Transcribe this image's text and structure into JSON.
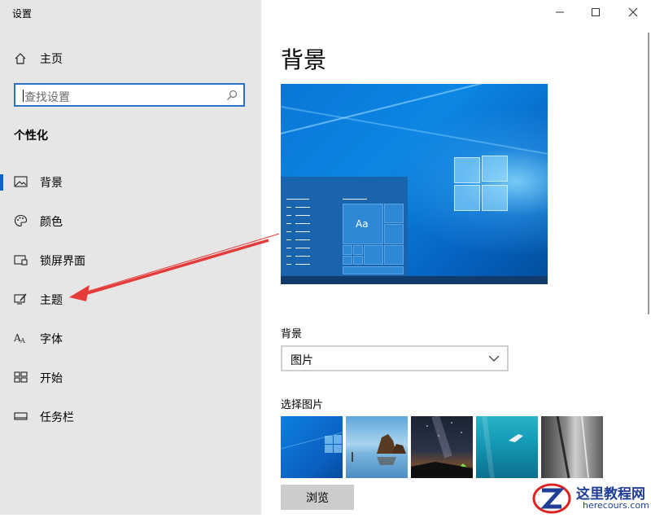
{
  "window": {
    "title": "设置"
  },
  "sidebar": {
    "home_label": "主页",
    "search_placeholder": "查找设置",
    "section_title": "个性化",
    "items": [
      {
        "label": "背景",
        "icon": "picture-icon",
        "active": true
      },
      {
        "label": "颜色",
        "icon": "palette-icon",
        "active": false
      },
      {
        "label": "锁屏界面",
        "icon": "lock-screen-icon",
        "active": false
      },
      {
        "label": "主题",
        "icon": "theme-brush-icon",
        "active": false
      },
      {
        "label": "字体",
        "icon": "font-icon",
        "active": false
      },
      {
        "label": "开始",
        "icon": "start-grid-icon",
        "active": false
      },
      {
        "label": "任务栏",
        "icon": "taskbar-icon",
        "active": false
      }
    ]
  },
  "main": {
    "page_title": "背景",
    "preview": {
      "sample_text": "Aa"
    },
    "background_label": "背景",
    "background_value": "图片",
    "choose_label": "选择图片",
    "browse_label": "浏览",
    "thumbnails": [
      "windows-hero-thumb",
      "beach-rocks-thumb",
      "starry-night-thumb",
      "underwater-diver-thumb",
      "rock-cliff-thumb"
    ]
  },
  "watermark": {
    "title": "这里教程网",
    "url": "herecours.com"
  },
  "colors": {
    "accent": "#0a64c8",
    "sidebar_bg": "#e6e6e6",
    "arrow": "#e53a3a"
  }
}
